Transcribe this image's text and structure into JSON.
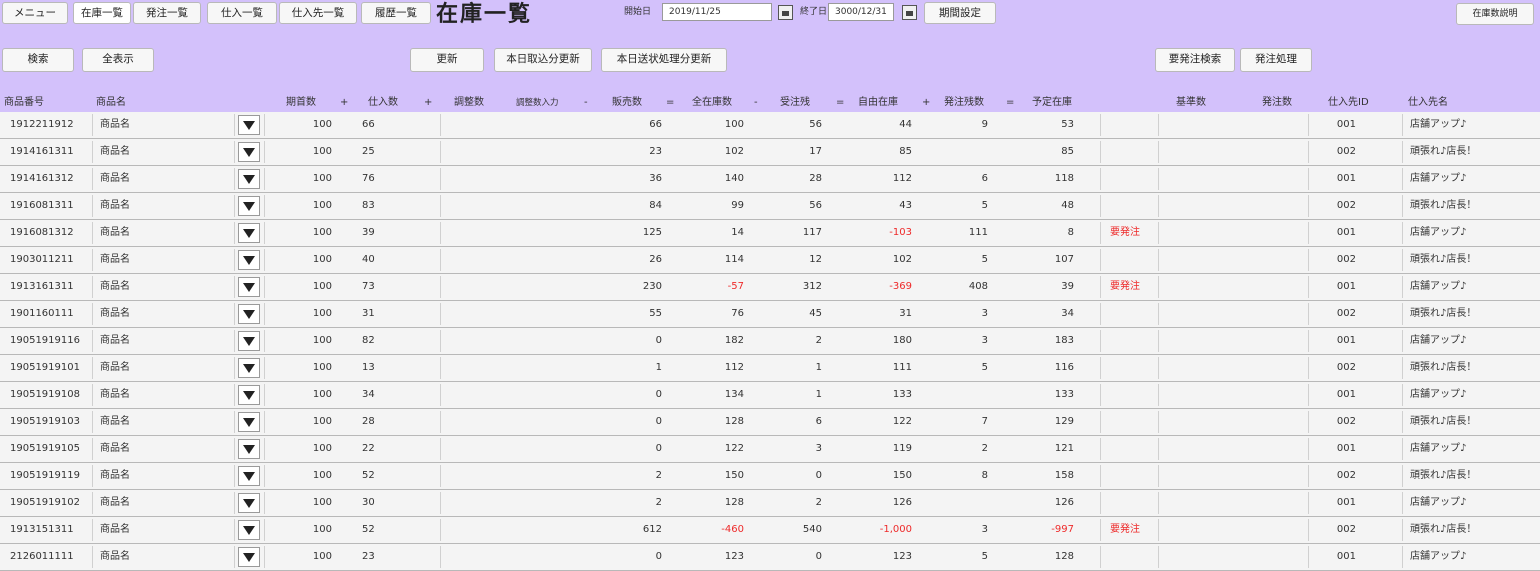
{
  "nav": {
    "menu": "メニュー",
    "stock_list": "在庫一覧",
    "order_list": "発注一覧",
    "purchase_list": "仕入一覧",
    "supplier_list": "仕入先一覧",
    "history_list": "履歴一覧"
  },
  "page_title": "在庫一覧",
  "period": {
    "start_label": "開始日",
    "start_value": "2019/11/25",
    "end_label": "終了日",
    "end_value": "3000/12/31",
    "set_button": "期間設定"
  },
  "help_button": "在庫数説明",
  "toolbar": {
    "search": "検索",
    "show_all": "全表示",
    "refresh": "更新",
    "today_import": "本日取込分更新",
    "today_shipping": "本日送状処理分更新",
    "needs_order_search": "要発注検索",
    "order_process": "発注処理"
  },
  "columns": {
    "product_no": "商品番号",
    "product_name": "商品名",
    "opening": "期首数",
    "op1": "+",
    "purchase": "仕入数",
    "op2": "+",
    "adjust": "調整数",
    "adjust_input": "調整数入力",
    "op3": "-",
    "sales": "販売数",
    "op4": "=",
    "total_stock": "全在庫数",
    "op5": "-",
    "received_orders": "受注残",
    "op6": "=",
    "free_stock": "自由在庫",
    "op7": "+",
    "order_remaining": "発注残数",
    "op8": "=",
    "planned_stock": "予定在庫",
    "base_qty": "基準数",
    "order_qty": "発注数",
    "supplier_id": "仕入先ID",
    "supplier_name": "仕入先名"
  },
  "colors": {
    "header_bg": "#d3c1fb",
    "negative": "#ee2a2a",
    "row_bg": "#f4f4f4"
  },
  "rows": [
    {
      "product_no": "1912211912",
      "name": "商品名",
      "opening": "100",
      "purchase": "66",
      "sales": "66",
      "total": "100",
      "received": "56",
      "free": "44",
      "order_rem": "9",
      "planned": "53",
      "flag": "",
      "supplier_id": "001",
      "supplier": "店舗アップ♪",
      "neg_total": false,
      "neg_free": false,
      "neg_planned": false
    },
    {
      "product_no": "1914161311",
      "name": "商品名",
      "opening": "100",
      "purchase": "25",
      "sales": "23",
      "total": "102",
      "received": "17",
      "free": "85",
      "order_rem": "",
      "planned": "85",
      "flag": "",
      "supplier_id": "002",
      "supplier": "頑張れ♪店長！",
      "neg_total": false,
      "neg_free": false,
      "neg_planned": false
    },
    {
      "product_no": "1914161312",
      "name": "商品名",
      "opening": "100",
      "purchase": "76",
      "sales": "36",
      "total": "140",
      "received": "28",
      "free": "112",
      "order_rem": "6",
      "planned": "118",
      "flag": "",
      "supplier_id": "001",
      "supplier": "店舗アップ♪",
      "neg_total": false,
      "neg_free": false,
      "neg_planned": false
    },
    {
      "product_no": "1916081311",
      "name": "商品名",
      "opening": "100",
      "purchase": "83",
      "sales": "84",
      "total": "99",
      "received": "56",
      "free": "43",
      "order_rem": "5",
      "planned": "48",
      "flag": "",
      "supplier_id": "002",
      "supplier": "頑張れ♪店長！",
      "neg_total": false,
      "neg_free": false,
      "neg_planned": false
    },
    {
      "product_no": "1916081312",
      "name": "商品名",
      "opening": "100",
      "purchase": "39",
      "sales": "125",
      "total": "14",
      "received": "117",
      "free": "-103",
      "order_rem": "111",
      "planned": "8",
      "flag": "要発注",
      "supplier_id": "001",
      "supplier": "店舗アップ♪",
      "neg_total": false,
      "neg_free": true,
      "neg_planned": false
    },
    {
      "product_no": "1903011211",
      "name": "商品名",
      "opening": "100",
      "purchase": "40",
      "sales": "26",
      "total": "114",
      "received": "12",
      "free": "102",
      "order_rem": "5",
      "planned": "107",
      "flag": "",
      "supplier_id": "002",
      "supplier": "頑張れ♪店長！",
      "neg_total": false,
      "neg_free": false,
      "neg_planned": false
    },
    {
      "product_no": "1913161311",
      "name": "商品名",
      "opening": "100",
      "purchase": "73",
      "sales": "230",
      "total": "-57",
      "received": "312",
      "free": "-369",
      "order_rem": "408",
      "planned": "39",
      "flag": "要発注",
      "supplier_id": "001",
      "supplier": "店舗アップ♪",
      "neg_total": true,
      "neg_free": true,
      "neg_planned": false
    },
    {
      "product_no": "1901160111",
      "name": "商品名",
      "opening": "100",
      "purchase": "31",
      "sales": "55",
      "total": "76",
      "received": "45",
      "free": "31",
      "order_rem": "3",
      "planned": "34",
      "flag": "",
      "supplier_id": "002",
      "supplier": "頑張れ♪店長！",
      "neg_total": false,
      "neg_free": false,
      "neg_planned": false
    },
    {
      "product_no": "19051919116",
      "name": "商品名",
      "opening": "100",
      "purchase": "82",
      "sales": "0",
      "total": "182",
      "received": "2",
      "free": "180",
      "order_rem": "3",
      "planned": "183",
      "flag": "",
      "supplier_id": "001",
      "supplier": "店舗アップ♪",
      "neg_total": false,
      "neg_free": false,
      "neg_planned": false
    },
    {
      "product_no": "19051919101",
      "name": "商品名",
      "opening": "100",
      "purchase": "13",
      "sales": "1",
      "total": "112",
      "received": "1",
      "free": "111",
      "order_rem": "5",
      "planned": "116",
      "flag": "",
      "supplier_id": "002",
      "supplier": "頑張れ♪店長！",
      "neg_total": false,
      "neg_free": false,
      "neg_planned": false
    },
    {
      "product_no": "19051919108",
      "name": "商品名",
      "opening": "100",
      "purchase": "34",
      "sales": "0",
      "total": "134",
      "received": "1",
      "free": "133",
      "order_rem": "",
      "planned": "133",
      "flag": "",
      "supplier_id": "001",
      "supplier": "店舗アップ♪",
      "neg_total": false,
      "neg_free": false,
      "neg_planned": false
    },
    {
      "product_no": "19051919103",
      "name": "商品名",
      "opening": "100",
      "purchase": "28",
      "sales": "0",
      "total": "128",
      "received": "6",
      "free": "122",
      "order_rem": "7",
      "planned": "129",
      "flag": "",
      "supplier_id": "002",
      "supplier": "頑張れ♪店長！",
      "neg_total": false,
      "neg_free": false,
      "neg_planned": false
    },
    {
      "product_no": "19051919105",
      "name": "商品名",
      "opening": "100",
      "purchase": "22",
      "sales": "0",
      "total": "122",
      "received": "3",
      "free": "119",
      "order_rem": "2",
      "planned": "121",
      "flag": "",
      "supplier_id": "001",
      "supplier": "店舗アップ♪",
      "neg_total": false,
      "neg_free": false,
      "neg_planned": false
    },
    {
      "product_no": "19051919119",
      "name": "商品名",
      "opening": "100",
      "purchase": "52",
      "sales": "2",
      "total": "150",
      "received": "0",
      "free": "150",
      "order_rem": "8",
      "planned": "158",
      "flag": "",
      "supplier_id": "002",
      "supplier": "頑張れ♪店長！",
      "neg_total": false,
      "neg_free": false,
      "neg_planned": false
    },
    {
      "product_no": "19051919102",
      "name": "商品名",
      "opening": "100",
      "purchase": "30",
      "sales": "2",
      "total": "128",
      "received": "2",
      "free": "126",
      "order_rem": "",
      "planned": "126",
      "flag": "",
      "supplier_id": "001",
      "supplier": "店舗アップ♪",
      "neg_total": false,
      "neg_free": false,
      "neg_planned": false
    },
    {
      "product_no": "1913151311",
      "name": "商品名",
      "opening": "100",
      "purchase": "52",
      "sales": "612",
      "total": "-460",
      "received": "540",
      "free": "-1,000",
      "order_rem": "3",
      "planned": "-997",
      "flag": "要発注",
      "supplier_id": "002",
      "supplier": "頑張れ♪店長！",
      "neg_total": true,
      "neg_free": true,
      "neg_planned": true
    },
    {
      "product_no": "2126011111",
      "name": "商品名",
      "opening": "100",
      "purchase": "23",
      "sales": "0",
      "total": "123",
      "received": "0",
      "free": "123",
      "order_rem": "5",
      "planned": "128",
      "flag": "",
      "supplier_id": "001",
      "supplier": "店舗アップ♪",
      "neg_total": false,
      "neg_free": false,
      "neg_planned": false
    }
  ]
}
